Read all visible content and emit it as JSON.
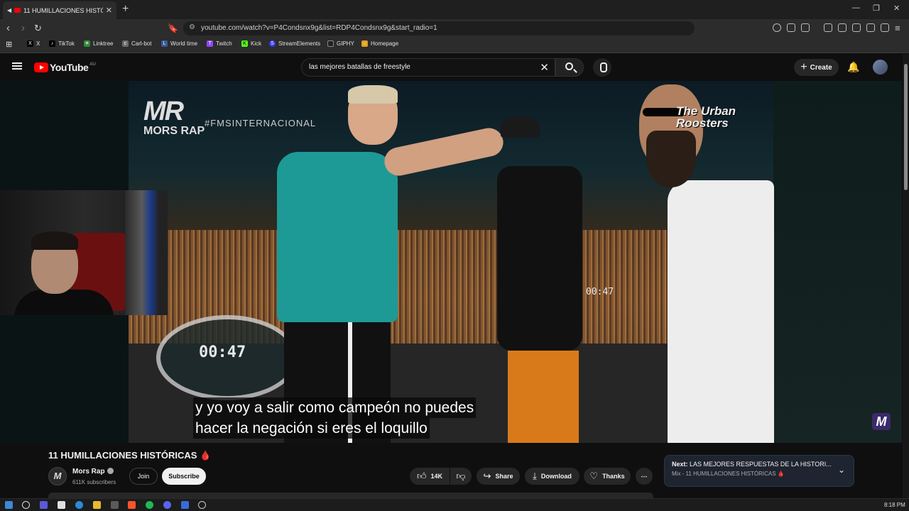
{
  "browser": {
    "tab_title": "11 HUMILLACIONES HISTÓRI",
    "url": "youtube.com/watch?v=P4Condsnx9g&list=RDP4Condsnx9g&start_radio=1",
    "bookmarks": [
      {
        "label": "X",
        "icon": "x-icon",
        "color": "#000000"
      },
      {
        "label": "TikTok",
        "icon": "tiktok-icon",
        "color": "#000000"
      },
      {
        "label": "Linktree",
        "icon": "linktree-icon",
        "color": "#43e660"
      },
      {
        "label": "Carl-bot",
        "icon": "carlbot-icon",
        "color": "#6a6a6a"
      },
      {
        "label": "World time",
        "icon": "worldtime-icon",
        "color": "#3a5a9a"
      },
      {
        "label": "Twitch",
        "icon": "twitch-icon",
        "color": "#9146ff"
      },
      {
        "label": "Kick",
        "icon": "kick-icon",
        "color": "#53fc18"
      },
      {
        "label": "StreamElements",
        "icon": "streamelements-icon",
        "color": "#3a3aff"
      },
      {
        "label": "GIPHY",
        "icon": "giphy-icon",
        "color": "#222222"
      },
      {
        "label": "Homepage",
        "icon": "homepage-icon",
        "color": "#e0a020"
      }
    ]
  },
  "youtube": {
    "logo_text": "YouTube",
    "region": "AU",
    "search_query": "las mejores batallas de freestyle",
    "create_label": "Create"
  },
  "video": {
    "overlay_logo_big": "MR",
    "overlay_logo_small": "MORS RAP",
    "overlay_intl": "#FMSINTERNACIONAL",
    "overlay_rooster": "The Urban Roosters",
    "timer_left": "00:47",
    "timer_right": "00:47",
    "subtitle_line1": "y yo voy a salir como campeón no puedes",
    "subtitle_line2": "hacer la negación si eres el loquillo",
    "corner_badge": "M"
  },
  "meta": {
    "title": "11 HUMILLACIONES HISTÓRICAS",
    "title_emoji": "🩸",
    "channel_name": "Mors Rap",
    "channel_initial": "M",
    "subscribers": "611K subscribers",
    "join_label": "Join",
    "subscribe_label": "Subscribe",
    "like_count": "14K",
    "share_label": "Share",
    "download_label": "Download",
    "thanks_label": "Thanks"
  },
  "next": {
    "prefix": "Next:",
    "title": "LAS MEJORES RESPUESTAS DE LA HISTORI...",
    "subtitle": "Mix - 11 HUMILLACIONES HISTÓRICAS 🩸"
  },
  "taskbar": {
    "time": "8:18 PM"
  }
}
